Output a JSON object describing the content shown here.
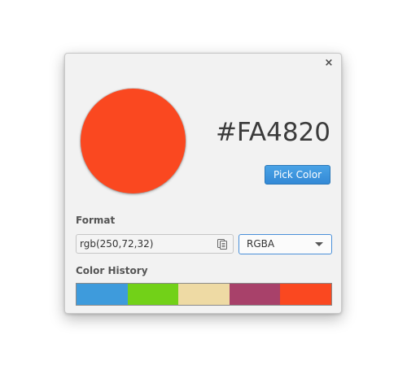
{
  "dialog": {
    "close_label": "×"
  },
  "current": {
    "hex": "#FA4820",
    "color": "#FA4820"
  },
  "actions": {
    "pick_label": "Pick Color"
  },
  "format": {
    "label": "Format",
    "value": "rgb(250,72,32)",
    "selected": "RGBA"
  },
  "history": {
    "label": "Color History",
    "colors": [
      "#3E9BDC",
      "#72D118",
      "#EEDAA4",
      "#A8416A",
      "#FA4820"
    ]
  },
  "icons": {
    "close": "close-icon",
    "copy": "copy-icon",
    "dropdown": "chevron-down-icon"
  }
}
